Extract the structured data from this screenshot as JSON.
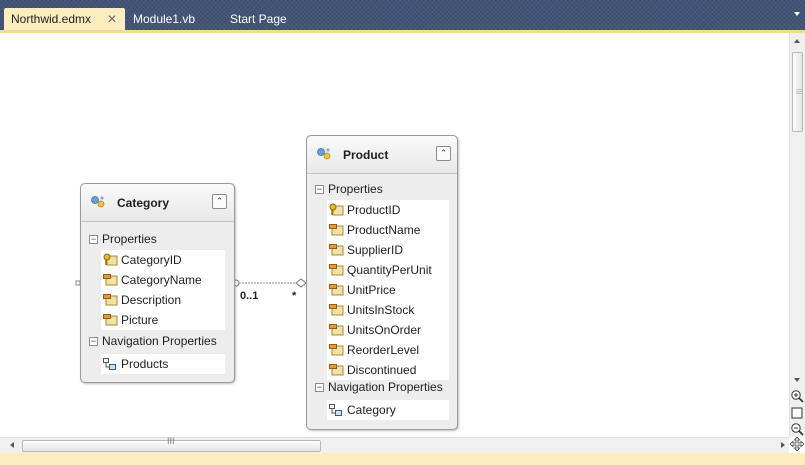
{
  "tabs": [
    {
      "label": "Northwid.edmx",
      "active": true,
      "close_glyph": "✕"
    },
    {
      "label": "Module1.vb",
      "active": false
    },
    {
      "label": "Start Page",
      "active": false
    }
  ],
  "entities": {
    "category": {
      "name": "Category",
      "icon": "entity-icon",
      "properties_label": "Properties",
      "properties": [
        {
          "name": "CategoryID",
          "key": true
        },
        {
          "name": "CategoryName",
          "key": false
        },
        {
          "name": "Description",
          "key": false
        },
        {
          "name": "Picture",
          "key": false
        }
      ],
      "nav_label": "Navigation Properties",
      "nav_properties": [
        "Products"
      ]
    },
    "product": {
      "name": "Product",
      "icon": "entity-icon",
      "properties_label": "Properties",
      "properties": [
        {
          "name": "ProductID",
          "key": true
        },
        {
          "name": "ProductName",
          "key": false
        },
        {
          "name": "SupplierID",
          "key": false
        },
        {
          "name": "QuantityPerUnit",
          "key": false
        },
        {
          "name": "UnitPrice",
          "key": false
        },
        {
          "name": "UnitsInStock",
          "key": false
        },
        {
          "name": "UnitsOnOrder",
          "key": false
        },
        {
          "name": "ReorderLevel",
          "key": false
        },
        {
          "name": "Discontinued",
          "key": false
        }
      ],
      "nav_label": "Navigation Properties",
      "nav_properties": [
        "Category"
      ]
    }
  },
  "association": {
    "left_multiplicity": "0..1",
    "right_multiplicity": "*"
  },
  "scroll": {
    "h_grip": "III"
  },
  "colors": {
    "tabstrip": "#3d4e70",
    "active_tab": "#fbedc0",
    "entity_bg": "#ededed"
  }
}
